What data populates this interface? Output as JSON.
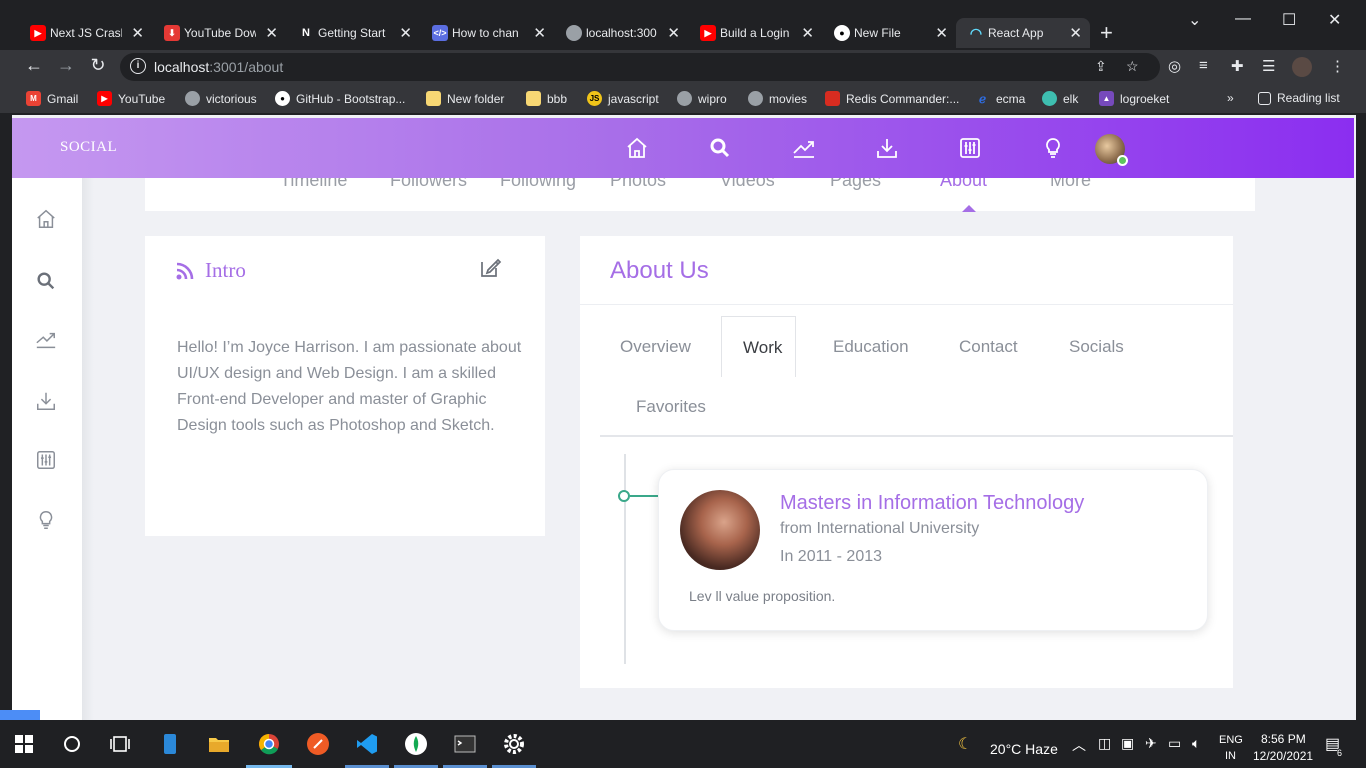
{
  "browser": {
    "tabs": [
      {
        "label": "Next JS Crash",
        "favicon": "youtube-icon",
        "color": "#ff0000"
      },
      {
        "label": "YouTube Dow",
        "favicon": "download-icon",
        "color": "#e53935"
      },
      {
        "label": "Getting Start",
        "favicon": "next-icon",
        "color": "#202124"
      },
      {
        "label": "How to chan",
        "favicon": "code-icon",
        "color": "#5b6ee1"
      },
      {
        "label": "localhost:300",
        "favicon": "globe-icon",
        "color": "#9aa0a6"
      },
      {
        "label": "Build a Login",
        "favicon": "youtube-icon",
        "color": "#ff0000"
      },
      {
        "label": "New File",
        "favicon": "github-icon",
        "color": "#ffffff"
      },
      {
        "label": "React App",
        "favicon": "react-icon",
        "color": "#61dafb"
      }
    ],
    "url_host": "localhost",
    "url_path": ":3001/about",
    "bookmarks": [
      {
        "label": "Gmail",
        "icon": "gmail-icon",
        "color": "#ea4335"
      },
      {
        "label": "YouTube",
        "icon": "youtube-icon",
        "color": "#ff0000"
      },
      {
        "label": "victorious",
        "icon": "globe-icon",
        "color": "#9aa0a6"
      },
      {
        "label": "GitHub - Bootstrap...",
        "icon": "github-icon",
        "color": "#ffffff"
      },
      {
        "label": "New folder",
        "icon": "folder-icon",
        "color": "#f7d774"
      },
      {
        "label": "bbb",
        "icon": "folder-icon",
        "color": "#f7d774"
      },
      {
        "label": "javascript",
        "icon": "js-icon",
        "color": "#f0c419"
      },
      {
        "label": "wipro",
        "icon": "globe-icon",
        "color": "#9aa0a6"
      },
      {
        "label": "movies",
        "icon": "globe-icon",
        "color": "#9aa0a6"
      },
      {
        "label": "Redis Commander:...",
        "icon": "redis-icon",
        "color": "#d82c20"
      },
      {
        "label": "ecma",
        "icon": "ecma-icon",
        "color": "#2f6de1"
      },
      {
        "label": "elk",
        "icon": "elk-icon",
        "color": "#3ebeb0"
      },
      {
        "label": "logroeket",
        "icon": "logrocket-icon",
        "color": "#764abc"
      }
    ],
    "more_bookmarks": "»",
    "reading_list": "Reading list"
  },
  "app": {
    "brand": "SOCIAL",
    "profile_tabs": [
      "Timeline",
      "Followers",
      "Following",
      "Photos",
      "Videos",
      "Pages",
      "About",
      "More"
    ],
    "active_profile_tab": "About",
    "intro": {
      "title": "Intro",
      "text": "Hello! I’m Joyce Harrison. I am passionate about UI/UX design and Web Design. I am a skilled Front-end Developer and master of Graphic Design tools such as Photoshop and Sketch."
    },
    "about": {
      "title": "About Us",
      "tabs": [
        "Overview",
        "Work",
        "Education",
        "Contact",
        "Socials",
        "Favorites"
      ],
      "active_tab": "Work",
      "entry": {
        "title": "Masters in Information Technology",
        "school": "from International University",
        "years": "In 2011 - 2013",
        "description": "Lev ll value proposition."
      }
    }
  },
  "taskbar": {
    "weather": "20°C  Haze",
    "lang_top": "ENG",
    "lang_bottom": "IN",
    "time": "8:56 PM",
    "date": "12/20/2021",
    "notifications": "6"
  },
  "colors": {
    "accent": "#a56ee6",
    "appbar_start": "#c598f0",
    "appbar_end": "#8b2ef0",
    "timeline": "#3aa88a"
  }
}
